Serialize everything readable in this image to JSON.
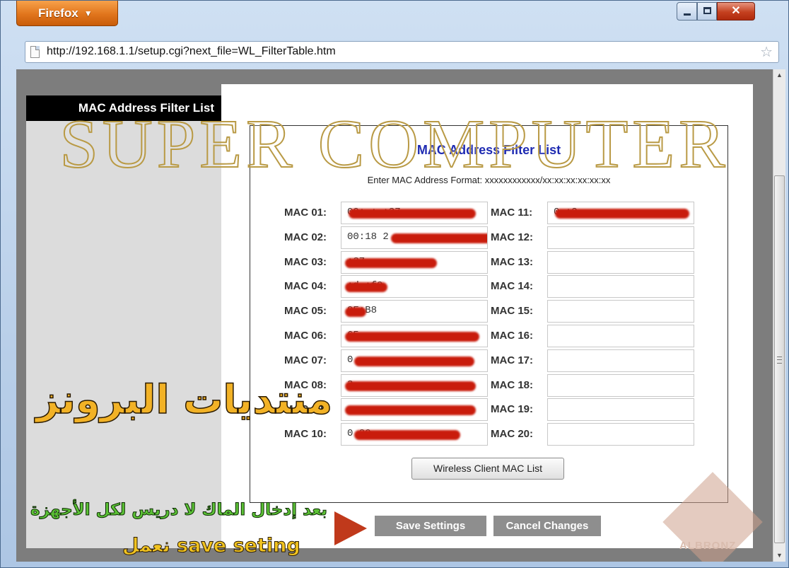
{
  "browser": {
    "menu_label": "Firefox",
    "url": "http://192.168.1.1/setup.cgi?next_file=WL_FilterTable.htm"
  },
  "sidebar": {
    "title": "MAC Address Filter List"
  },
  "panel": {
    "title": "MAC Address Filter List",
    "format_hint": "Enter MAC Address Format: xxxxxxxxxxxx/xx:xx:xx:xx:xx:xx"
  },
  "mac_entries": [
    {
      "label": "MAC 01:",
      "value": "00:       :    :37"
    },
    {
      "label": "MAC 02:",
      "value": "00:18        2"
    },
    {
      "label": "MAC 03:",
      "value": "           :37"
    },
    {
      "label": "MAC 04:",
      "value": "    :d :f0"
    },
    {
      "label": "MAC 05:",
      "value": "    0F:B8"
    },
    {
      "label": "MAC 06:",
      "value": "    65"
    },
    {
      "label": "MAC 07:",
      "value": "0"
    },
    {
      "label": "MAC 08:",
      "value": "             3"
    },
    {
      "label": "MAC 09:",
      "value": ""
    },
    {
      "label": "MAC 10:",
      "value": "0             20"
    },
    {
      "label": "MAC 11:",
      "value": "0        :2"
    },
    {
      "label": "MAC 12:",
      "value": ""
    },
    {
      "label": "MAC 13:",
      "value": ""
    },
    {
      "label": "MAC 14:",
      "value": ""
    },
    {
      "label": "MAC 15:",
      "value": ""
    },
    {
      "label": "MAC 16:",
      "value": ""
    },
    {
      "label": "MAC 17:",
      "value": ""
    },
    {
      "label": "MAC 18:",
      "value": ""
    },
    {
      "label": "MAC 19:",
      "value": ""
    },
    {
      "label": "MAC 20:",
      "value": ""
    }
  ],
  "buttons": {
    "wireless_client": "Wireless Client MAC List",
    "save": "Save Settings",
    "cancel": "Cancel Changes"
  },
  "overlay": {
    "watermark": "SUPER COMPUTER",
    "forum_name": "منتديات البرونز",
    "instruction": "بعد إدخال الماك لا دريس لكل الأجهزة",
    "instruction_2": "نعمل save seting",
    "logo_text": "ALBRONZ"
  }
}
